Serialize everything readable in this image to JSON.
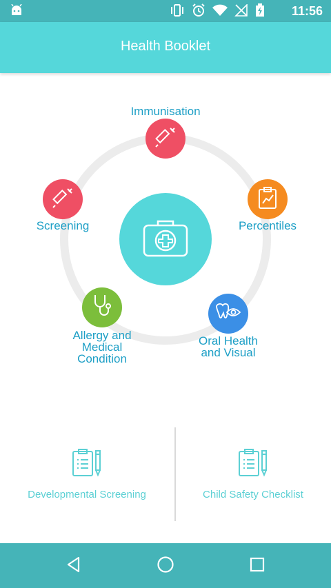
{
  "status_bar": {
    "time": "11:56",
    "icons": [
      "android-icon",
      "vibrate-icon",
      "alarm-icon",
      "wifi-icon",
      "no-signal-icon",
      "battery-charging-icon"
    ]
  },
  "app_bar": {
    "title": "Health Booklet"
  },
  "center": {
    "icon": "first-aid-kit-icon",
    "color": "#55d7da"
  },
  "ring_items": [
    {
      "id": "immunisation",
      "label": "Immunisation",
      "icon": "syringe-icon",
      "color": "#ef4f64"
    },
    {
      "id": "percentiles",
      "label": "Percentiles",
      "icon": "clipboard-chart-icon",
      "color": "#f58b20"
    },
    {
      "id": "oral-health",
      "label_lines": [
        "Oral Health",
        "and Visual"
      ],
      "icon": "tooth-eye-icon",
      "color": "#3b8fe6"
    },
    {
      "id": "allergy",
      "label_lines": [
        "Allergy and",
        "Medical",
        "Condition"
      ],
      "icon": "stethoscope-icon",
      "color": "#7cbe3b"
    },
    {
      "id": "screening",
      "label": "Screening",
      "icon": "syringe-icon",
      "color": "#ef4f64"
    }
  ],
  "bottom_items": [
    {
      "label": "Developmental Screening",
      "icon": "clipboard-pencil-icon"
    },
    {
      "label": "Child Safety Checklist",
      "icon": "clipboard-pencil-icon"
    }
  ],
  "nav_bar": {
    "buttons": [
      "back",
      "home",
      "recents"
    ]
  },
  "colors": {
    "accent": "#55d7da",
    "status": "#45b4b8",
    "label": "#1d9fc6",
    "bottom_label": "#5cd0d4",
    "ring": "#ececec"
  }
}
